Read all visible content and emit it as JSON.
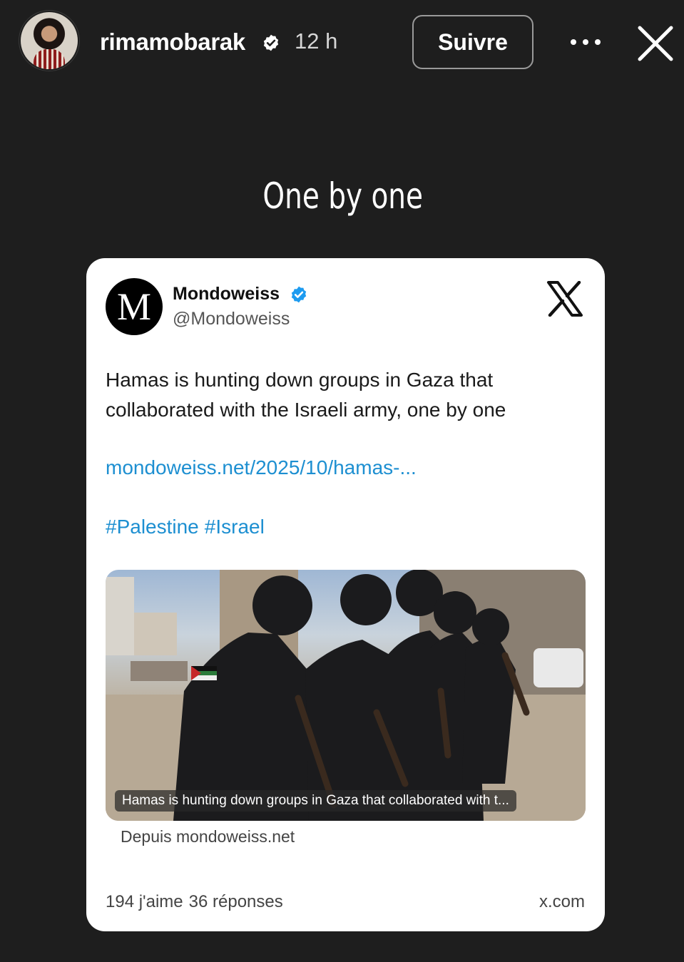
{
  "story": {
    "username": "rimamobarak",
    "time": "12 h",
    "follow_label": "Suivre",
    "icons": {
      "more": "more-horizontal-icon",
      "close": "close-icon",
      "verified": "verified-badge-icon"
    }
  },
  "caption": "One by one",
  "tweet": {
    "logo_letter": "M",
    "account_name": "Mondoweiss",
    "handle": "@Mondoweiss",
    "text": "Hamas is hunting down groups in Gaza that collaborated with the Israeli army, one by one",
    "link": "mondoweiss.net/2025/10/hamas-...",
    "hashtags": [
      "#Palestine",
      "#Israel"
    ],
    "media_caption": "Hamas is hunting down groups in Gaza that collaborated with t...",
    "source": "Depuis mondoweiss.net",
    "likes": "194 j'aime",
    "replies": "36 réponses",
    "domain": "x.com",
    "colors": {
      "link": "#1d8fd1",
      "verified": "#1d9bf0"
    },
    "icons": {
      "platform": "x-logo-icon",
      "verified": "verified-blue-icon"
    }
  }
}
